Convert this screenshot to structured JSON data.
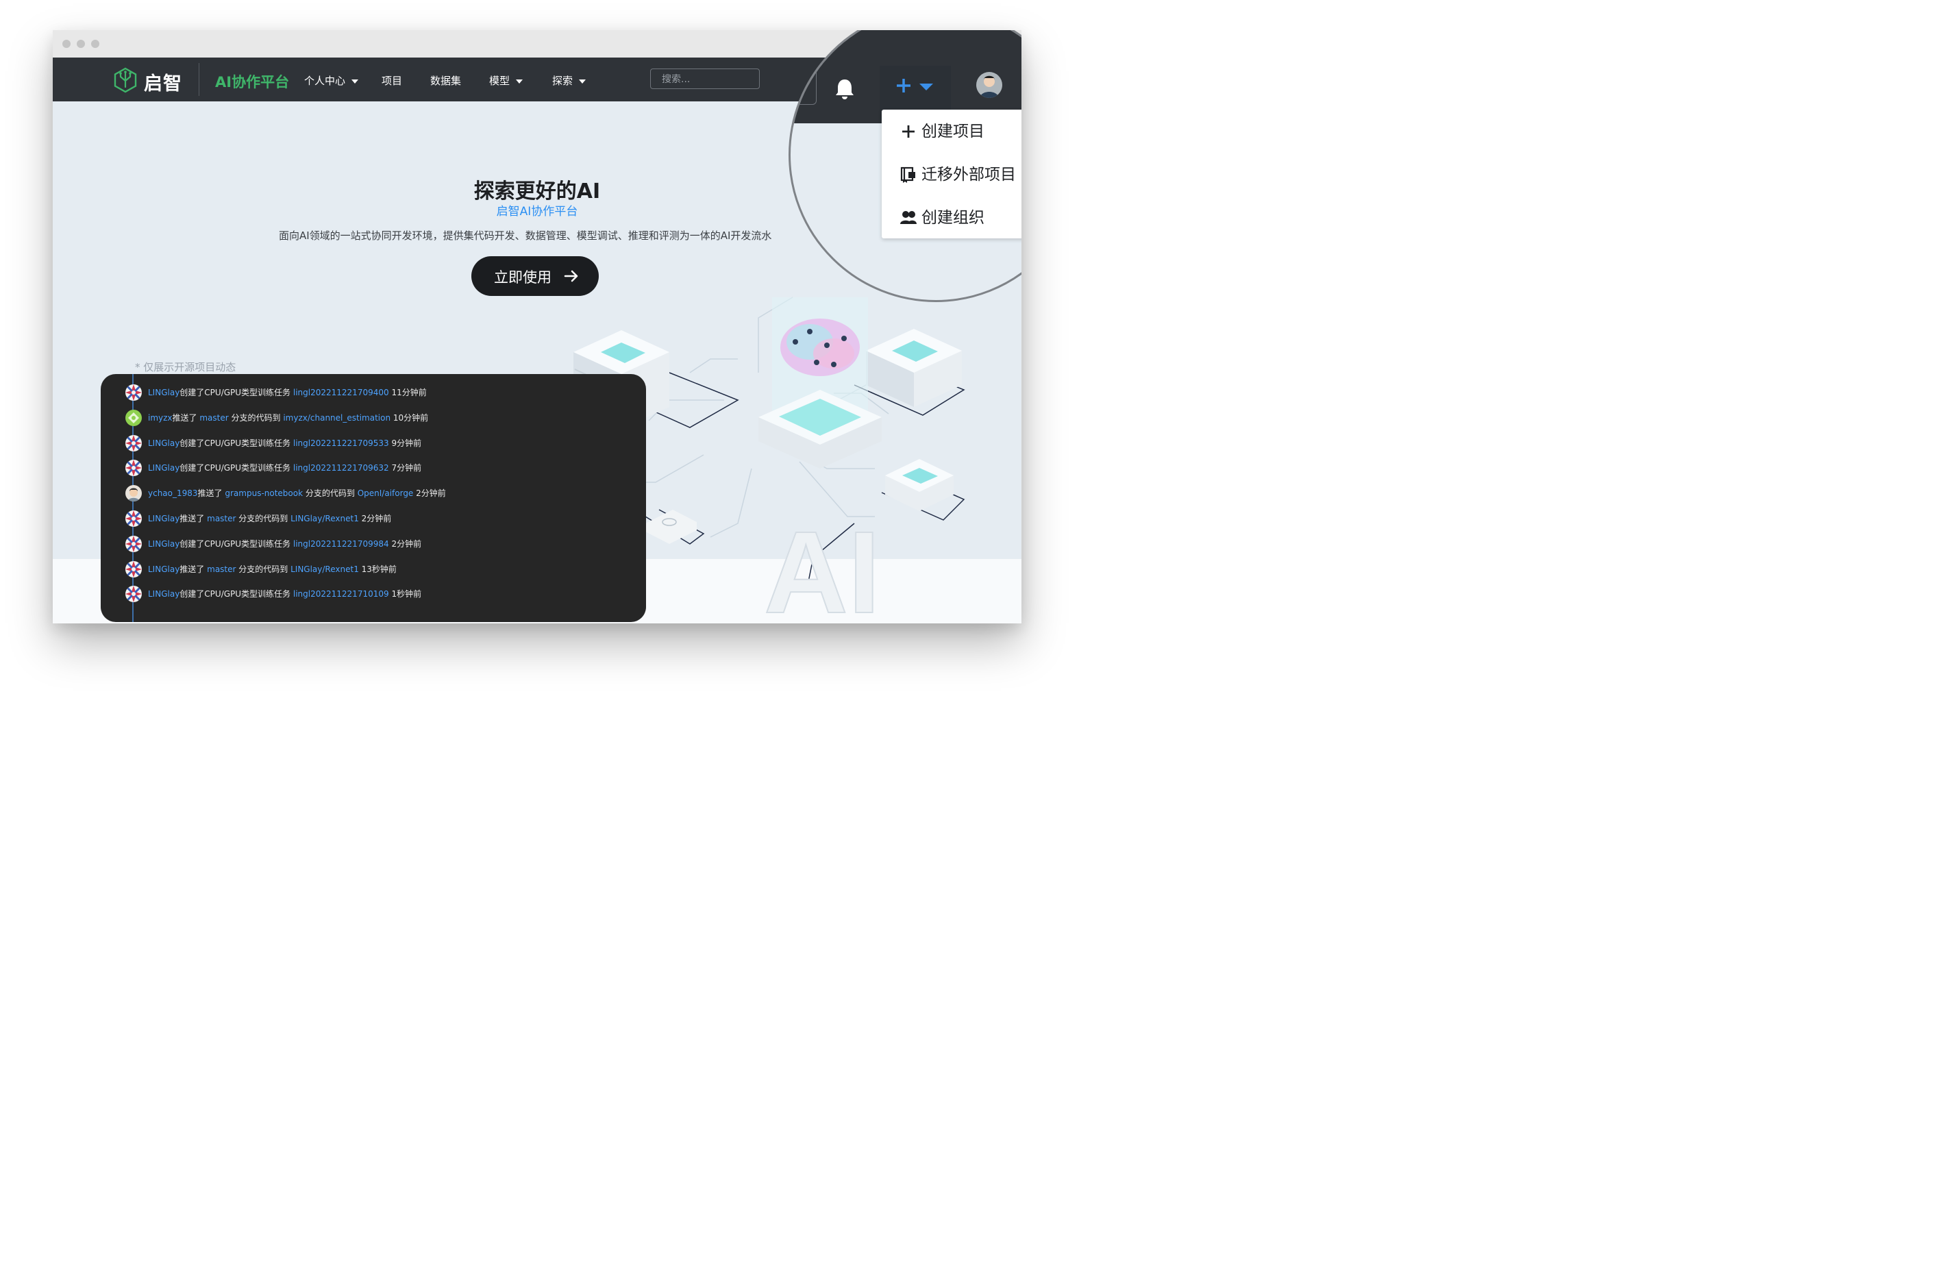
{
  "brand": {
    "logo_text": "启智",
    "platform_name": "AI协作平台",
    "accent_color": "#3fb66a",
    "link_color": "#4ea3ff"
  },
  "nav": {
    "items": [
      {
        "label": "个人中心",
        "has_dropdown": true
      },
      {
        "label": "项目",
        "has_dropdown": false
      },
      {
        "label": "数据集",
        "has_dropdown": false
      },
      {
        "label": "模型",
        "has_dropdown": true
      },
      {
        "label": "探索",
        "has_dropdown": true
      }
    ],
    "search_placeholder": "搜索..."
  },
  "hero": {
    "title": "探索更好的AI",
    "subtitle": "启智AI协作平台",
    "description": "面向AI领域的一站式协同开发环境，提供集代码开发、数据管理、模型调试、推理和评测为一体的AI开发流水",
    "cta_label": "立即使用",
    "illustration_text": "AI"
  },
  "activity": {
    "note": "* 仅展示开源项目动态",
    "rows": [
      {
        "avatar": "pattern",
        "user": "LINGlay",
        "action": "创建了CPU/GPU类型训练任务 ",
        "branch": "",
        "mid": "",
        "target": "lingl202211221709400",
        "time": " 11分钟前"
      },
      {
        "avatar": "green",
        "user": "imyzx",
        "action": "推送了 ",
        "branch": "master",
        "mid": " 分支的代码到 ",
        "target": "imyzx/channel_estimation",
        "time": " 10分钟前"
      },
      {
        "avatar": "pattern",
        "user": "LINGlay",
        "action": "创建了CPU/GPU类型训练任务 ",
        "branch": "",
        "mid": "",
        "target": "lingl202211221709533",
        "time": " 9分钟前"
      },
      {
        "avatar": "pattern",
        "user": "LINGlay",
        "action": "创建了CPU/GPU类型训练任务 ",
        "branch": "",
        "mid": "",
        "target": "lingl202211221709632",
        "time": " 7分钟前"
      },
      {
        "avatar": "photo",
        "user": "ychao_1983",
        "action": "推送了 ",
        "branch": "grampus-notebook",
        "mid": " 分支的代码到 ",
        "target": "OpenI/aiforge",
        "time": " 2分钟前"
      },
      {
        "avatar": "pattern",
        "user": "LINGlay",
        "action": "推送了 ",
        "branch": "master",
        "mid": " 分支的代码到 ",
        "target": "LINGlay/Rexnet1",
        "time": " 2分钟前"
      },
      {
        "avatar": "pattern",
        "user": "LINGlay",
        "action": "创建了CPU/GPU类型训练任务 ",
        "branch": "",
        "mid": "",
        "target": "lingl202211221709984",
        "time": " 2分钟前"
      },
      {
        "avatar": "pattern",
        "user": "LINGlay",
        "action": "推送了 ",
        "branch": "master",
        "mid": " 分支的代码到 ",
        "target": "LINGlay/Rexnet1",
        "time": " 13秒钟前"
      },
      {
        "avatar": "pattern",
        "user": "LINGlay",
        "action": "创建了CPU/GPU类型训练任务 ",
        "branch": "",
        "mid": "",
        "target": "lingl202211221710109",
        "time": " 1秒钟前"
      }
    ]
  },
  "create_menu": {
    "items": [
      {
        "label": "创建项目",
        "icon": "plus-icon"
      },
      {
        "label": "迁移外部项目",
        "icon": "migrate-icon"
      },
      {
        "label": "创建组织",
        "icon": "users-icon"
      }
    ]
  },
  "icons": {
    "notifications": "bell-icon",
    "create": "plus-icon",
    "user_menu": "avatar"
  }
}
